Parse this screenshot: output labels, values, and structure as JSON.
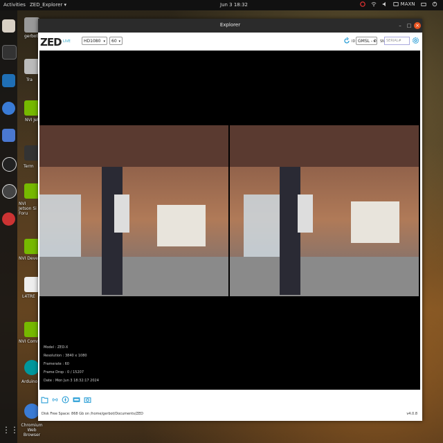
{
  "topbar": {
    "activities": "Activities",
    "app_menu": "ZED_Explorer ▾",
    "clock": "Jun 3 18:32",
    "power_mode": "MAXN"
  },
  "desktop_icons": [
    {
      "label": "gerbot"
    },
    {
      "label": "Tra"
    },
    {
      "label": "NVI Jetso"
    },
    {
      "label": "Term"
    },
    {
      "label": "NVI Jetson Si Foru"
    },
    {
      "label": "NVI Develo"
    },
    {
      "label": "L4TRE"
    },
    {
      "label": "NVI Commun"
    },
    {
      "label": "Arduino IDE"
    },
    {
      "label": "Chromium Web Browser"
    }
  ],
  "window": {
    "title": "Explorer",
    "logo": "ZED",
    "live_label": "LIVE",
    "resolution": "HD1080",
    "fps": "60",
    "id_label": "ID",
    "id_value": "GMSL - 0",
    "sn_label": "SN",
    "sn_placeholder": "SERIAL#"
  },
  "camera_info": {
    "model": "Model : ZED-X",
    "resolution": "Resolution : 3840 x 1080",
    "framerate": "Framerate : 60",
    "frame_drop": "Frame Drop : 0 / 15207",
    "date": "Date : Mon Jun 3 18:32:17 2024"
  },
  "footer": {
    "disk": "Disk Free Space: 868 Gb  on /home/gerbot/Documents/ZED",
    "version": "v4.0.8"
  }
}
